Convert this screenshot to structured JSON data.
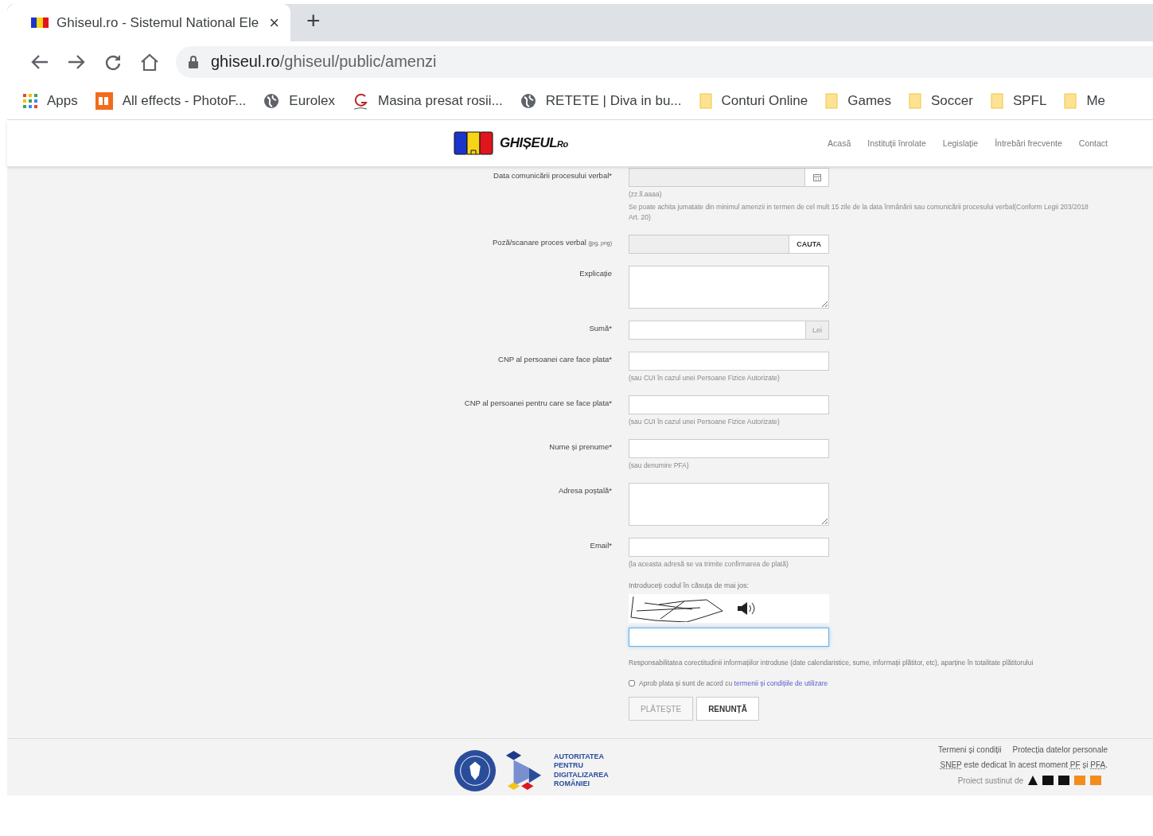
{
  "browser": {
    "tab": {
      "title": "Ghiseul.ro - Sistemul National Ele",
      "close": "×",
      "selected": true
    },
    "new_tab": "+",
    "url": {
      "domain": "ghiseul.ro",
      "path": "/ghiseul/public/amenzi"
    },
    "bookmarks": [
      {
        "label": "Apps",
        "kind": "apps"
      },
      {
        "label": "All effects - PhotoF...",
        "kind": "pf"
      },
      {
        "label": "Eurolex",
        "kind": "globe"
      },
      {
        "label": "Masina presat rosii...",
        "kind": "g"
      },
      {
        "label": "RETETE | Diva in bu...",
        "kind": "globe"
      },
      {
        "label": "Conturi Online",
        "kind": "folder"
      },
      {
        "label": "Games",
        "kind": "folder"
      },
      {
        "label": "Soccer",
        "kind": "folder"
      },
      {
        "label": "SPFL",
        "kind": "folder"
      },
      {
        "label": "Me",
        "kind": "folder"
      }
    ]
  },
  "site": {
    "logo": {
      "name": "GHIȘEUL",
      "suffix": "Ro"
    },
    "nav": [
      "Acasă",
      "Instituții înrolate",
      "Legislație",
      "Întrebări frecvente",
      "Contact"
    ]
  },
  "form": {
    "fields": [
      {
        "kind": "date",
        "label": "Data comunicării procesului verbal*",
        "hints": [
          "(zz.ll.aaaa)",
          "Se poate achita jumatate din minimul amenzii in termen de cel mult 15 zile de la data înmânării sau comunicării procesului verbal(Conform Legii 203/2018 Art. 20)"
        ]
      },
      {
        "kind": "file",
        "label": "Poză/scanare proces verbal",
        "label_note": "(jpg, png)",
        "button": "CAUTA"
      },
      {
        "kind": "textarea",
        "label": "Explicație"
      },
      {
        "kind": "amount",
        "label": "Sumă*",
        "addon": "Lei"
      },
      {
        "kind": "text",
        "label": "CNP al persoanei care face plata*",
        "hints": [
          "(sau CUI în cazul unei Persoane Fizice Autorizate)"
        ]
      },
      {
        "kind": "text",
        "label": "CNP al persoanei pentru care se face plata*",
        "hints": [
          "(sau CUI în cazul unei Persoane Fizice Autorizate)"
        ]
      },
      {
        "kind": "text",
        "label": "Nume și prenume*",
        "hints": [
          "(sau denumire PFA)"
        ]
      },
      {
        "kind": "textarea",
        "label": "Adresa poștală*"
      },
      {
        "kind": "text",
        "label": "Email*",
        "hints": [
          "(la aceasta adresă se va trimite confirmarea de plată)"
        ]
      }
    ],
    "captcha": {
      "label": "Introduceți codul în căsuța de mai jos:",
      "focused": true
    },
    "disclaimer": "Responsabilitatea corectitudinii informațiilor introduse (date calendaristice, sume, informații plătitor, etc), aparține în totalitate plătitorului",
    "agree": {
      "text": "Aprob plata și sunt de acord cu",
      "link": "termenii și condițiile de utilizare",
      "checked": false
    },
    "buttons": [
      {
        "label": "PLĂTEȘTE",
        "disabled": true
      },
      {
        "label": "RENUNȚĂ",
        "disabled": false
      }
    ]
  },
  "footer": {
    "agency": [
      "AUTORITATEA",
      "PENTRU",
      "DIGITALIZAREA",
      "ROMÂNIEI"
    ],
    "links": [
      "Termeni și condiții",
      "Protecția datelor personale"
    ],
    "note": "*SNEP* este dedicat în acest moment *PF* și *PFA*.",
    "sponsor": "Proiect sustinut de"
  }
}
